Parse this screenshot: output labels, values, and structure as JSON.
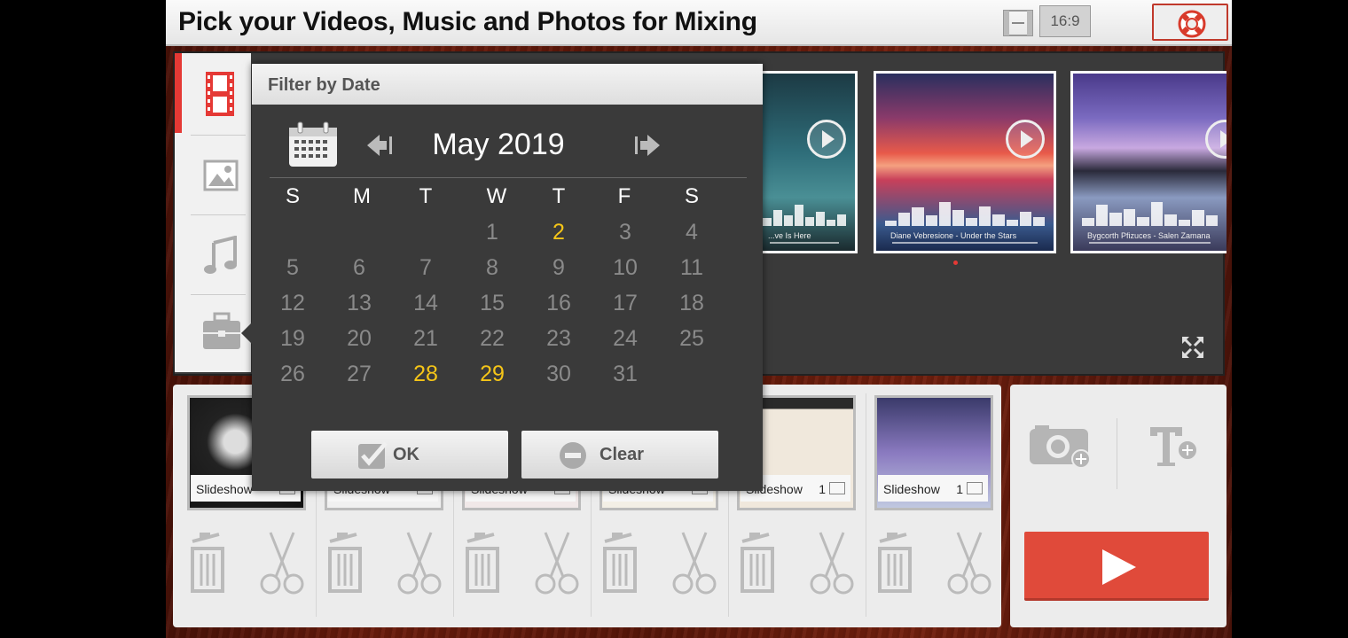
{
  "header": {
    "title": "Pick your Videos, Music and Photos for Mixing",
    "ratio_label": "16:9"
  },
  "sidebar": {
    "items": [
      {
        "name": "video",
        "icon": "film-strip-icon",
        "active": true
      },
      {
        "name": "photo",
        "icon": "picture-icon",
        "active": false
      },
      {
        "name": "music",
        "icon": "music-note-icon",
        "active": false
      },
      {
        "name": "toolbox",
        "icon": "briefcase-icon",
        "active": false
      }
    ]
  },
  "media_thumbs": [
    {
      "caption": "...ve Is Here"
    },
    {
      "caption": "Diane Vebresione - Under the Stars"
    },
    {
      "caption": "Bygcorth Pfizuces - Salen Zamana"
    }
  ],
  "dialog": {
    "title": "Filter by Date",
    "month": "May 2019",
    "weekdays": [
      "S",
      "M",
      "T",
      "W",
      "T",
      "F",
      "S"
    ],
    "weeks": [
      [
        "",
        "",
        "",
        "1",
        "2",
        "3",
        "4"
      ],
      [
        "5",
        "6",
        "7",
        "8",
        "9",
        "10",
        "11"
      ],
      [
        "12",
        "13",
        "14",
        "15",
        "16",
        "17",
        "18"
      ],
      [
        "19",
        "20",
        "21",
        "22",
        "23",
        "24",
        "25"
      ],
      [
        "26",
        "27",
        "28",
        "29",
        "30",
        "31",
        ""
      ]
    ],
    "highlighted_days": [
      "2",
      "28",
      "29"
    ],
    "ok_label": "OK",
    "clear_label": "Clear"
  },
  "timeline": {
    "slots": [
      {
        "label": "Slideshow",
        "count": ""
      },
      {
        "label": "Slideshow",
        "count": ""
      },
      {
        "label": "Slideshow",
        "count": ""
      },
      {
        "label": "Slideshow",
        "count": ""
      },
      {
        "label": "Slideshow",
        "count": "1"
      },
      {
        "label": "Slideshow",
        "count": "1"
      }
    ]
  },
  "colors": {
    "accent": "#e53935",
    "highlight_day": "#f5c518",
    "play_button": "#e04a3a"
  }
}
